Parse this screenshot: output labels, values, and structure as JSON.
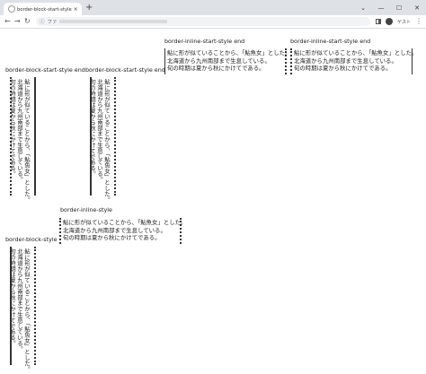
{
  "browser": {
    "tab_title": "border-block-start-styleプロパテ",
    "tab_close": "×",
    "new_tab": "+",
    "window_controls": [
      "⌄",
      "—",
      "☐",
      "✕"
    ],
    "nav": {
      "back": "←",
      "forward": "→",
      "reload": "↻"
    },
    "address_prefix": "ファ",
    "info_icon": "ⓘ",
    "guest_label": "ゲスト",
    "menu_glyph": "⋮"
  },
  "text_lines": [
    "鮎に形が似ていることから、「鮎魚女」とした。",
    "北海道から九州南部まで生息している。",
    "旬の時期は夏から秋にかけてである。"
  ],
  "demos": [
    {
      "label": "border-block-start-style end"
    },
    {
      "label": "border-block-start-style end"
    },
    {
      "label": "border-inline-start-style end"
    },
    {
      "label": "border-inline-start-style end"
    },
    {
      "label": "border-inline-style"
    },
    {
      "label": "border-block-style"
    }
  ]
}
